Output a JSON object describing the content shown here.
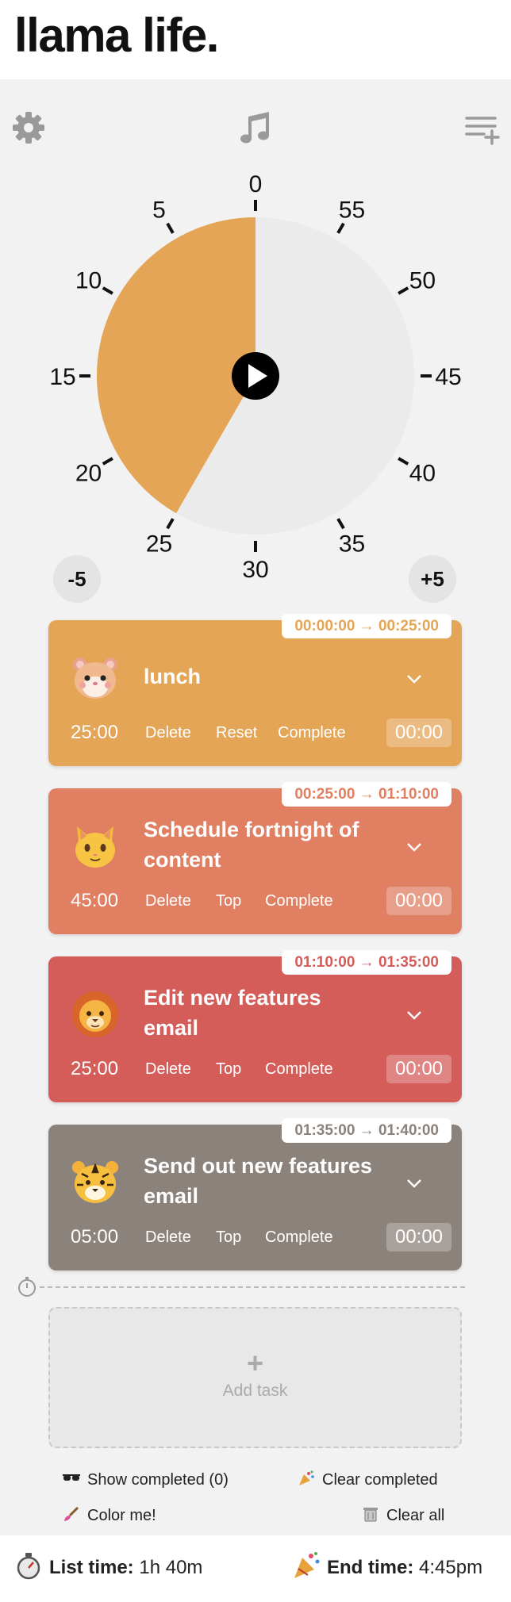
{
  "app": {
    "logo": "llama life."
  },
  "toolbar": {
    "settings_icon": "gear-icon",
    "music_icon": "music-note-icon",
    "add_list_icon": "add-list-icon"
  },
  "timer": {
    "labels": [
      "0",
      "5",
      "10",
      "15",
      "20",
      "25",
      "30",
      "35",
      "40",
      "45",
      "50",
      "55"
    ],
    "remaining_minutes": 25,
    "fill_color": "#e5a557",
    "face_color": "#ebebeb",
    "play_icon": "play-icon"
  },
  "adjust": {
    "minus": "-5",
    "plus": "+5"
  },
  "tasks": [
    {
      "range": "00:00:00 → 00:25:00",
      "emoji": "hamster-emoji",
      "name": "lunch",
      "duration": "25:00",
      "actions": [
        "Delete",
        "Reset",
        "Complete"
      ],
      "timer": "00:00",
      "color": "#e5a557"
    },
    {
      "range": "00:25:00 → 01:10:00",
      "emoji": "cat-emoji",
      "name": "Schedule fortnight of content",
      "duration": "45:00",
      "actions": [
        "Delete",
        "Top",
        "Complete"
      ],
      "timer": "00:00",
      "color": "#e07f62"
    },
    {
      "range": "01:10:00 → 01:35:00",
      "emoji": "lion-emoji",
      "name": "Edit new features email",
      "duration": "25:00",
      "actions": [
        "Delete",
        "Top",
        "Complete"
      ],
      "timer": "00:00",
      "color": "#d45d5a"
    },
    {
      "range": "01:35:00 → 01:40:00",
      "emoji": "tiger-emoji",
      "name": "Send out new features email",
      "duration": "05:00",
      "actions": [
        "Delete",
        "Top",
        "Complete"
      ],
      "timer": "00:00",
      "color": "#8b827b"
    }
  ],
  "add_task": {
    "plus": "+",
    "label": "Add task"
  },
  "footer": {
    "show_completed": "Show completed (0)",
    "clear_completed": "Clear completed",
    "color_me": "Color me!",
    "clear_all": "Clear all"
  },
  "summary": {
    "list_time_label": "List time:",
    "list_time_value": "1h 40m",
    "end_time_label": "End time:",
    "end_time_value": "4:45pm"
  }
}
